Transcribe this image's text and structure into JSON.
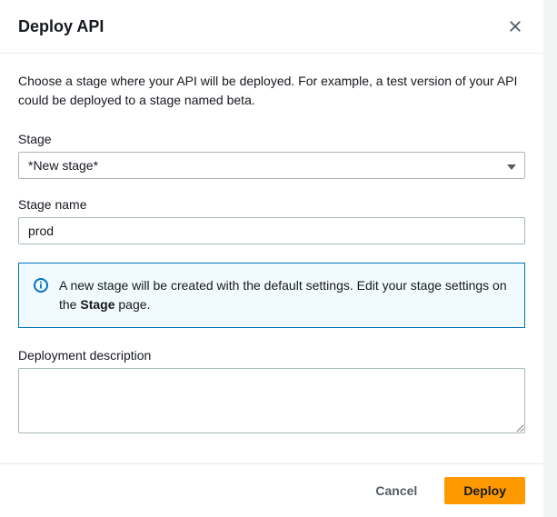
{
  "header": {
    "title": "Deploy API"
  },
  "body": {
    "description": "Choose a stage where your API will be deployed. For example, a test version of your API could be deployed to a stage named beta.",
    "stage": {
      "label": "Stage",
      "selected": "*New stage*"
    },
    "stageName": {
      "label": "Stage name",
      "value": "prod"
    },
    "info": {
      "text_pre": "A new stage will be created with the default settings. Edit your stage settings on the ",
      "strong": "Stage",
      "text_post": " page."
    },
    "deploymentDescription": {
      "label": "Deployment description",
      "value": ""
    }
  },
  "footer": {
    "cancel": "Cancel",
    "deploy": "Deploy"
  }
}
